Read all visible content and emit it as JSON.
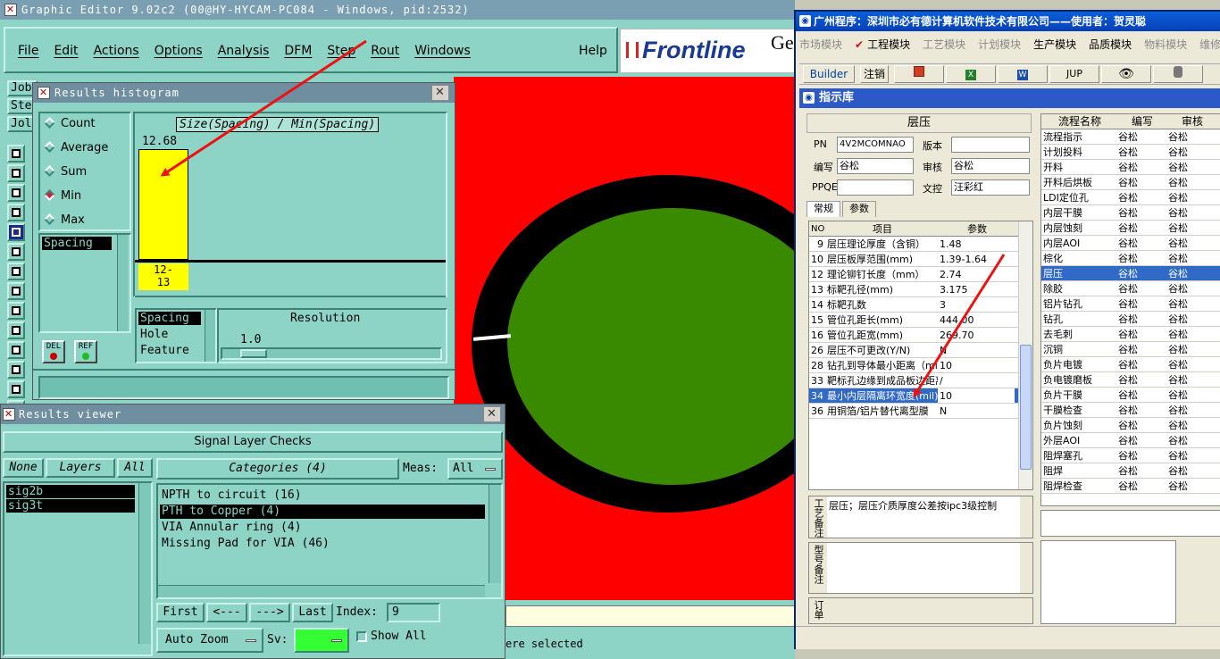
{
  "graphic_editor": {
    "title": "Graphic Editor 9.02c2 (00@HY-HYCAM-PC084 - Windows, pid:2532)",
    "menu": [
      "File",
      "Edit",
      "Actions",
      "Options",
      "Analysis",
      "DFM",
      "Step",
      "Rout",
      "Windows"
    ],
    "help": "Help",
    "logo": "Frontline",
    "logo_suffix": "Ge",
    "side_labels": [
      "Job",
      "Ste",
      "Jol"
    ],
    "status_text": "ere selected",
    "colors": {
      "canvas": "#ff0000",
      "ring": "#000000",
      "pad": "#3a8a00"
    }
  },
  "histogram": {
    "title": "Results histogram",
    "modes": [
      {
        "label": "Count",
        "selected": false
      },
      {
        "label": "Average",
        "selected": false
      },
      {
        "label": "Sum",
        "selected": false
      },
      {
        "label": "Min",
        "selected": true
      },
      {
        "label": "Max",
        "selected": false
      }
    ],
    "list_item": "Spacing",
    "del_label": "DEL",
    "ref_label": "REF",
    "chart_title": "Size(Spacing) / Min(Spacing)",
    "bar_value": "12.68",
    "bar_category": "12-\n13",
    "types": [
      "Spacing",
      "Hole",
      "Feature"
    ],
    "resolution_label": "Resolution",
    "resolution_value": "1.0"
  },
  "results_viewer": {
    "title": "Results viewer",
    "header": "Signal Layer Checks",
    "none_label": "None",
    "layers_label": "Layers",
    "all_label": "All",
    "layers": [
      "sig2b",
      "sig3t"
    ],
    "categories_label": "Categories (4)",
    "meas_label": "Meas:",
    "meas_value": "All",
    "categories": [
      {
        "label": "NPTH to circuit (16)",
        "selected": false
      },
      {
        "label": "PTH to Copper (4)",
        "selected": true
      },
      {
        "label": "VIA Annular ring (4)",
        "selected": false
      },
      {
        "label": "Missing Pad for VIA (46)",
        "selected": false
      }
    ],
    "first_label": "First",
    "prev_label": "<---",
    "next_label": "--->",
    "last_label": "Last",
    "index_label": "Index:",
    "index_value": "9",
    "auto_zoom_label": "Auto Zoom",
    "sv_label": "Sv:",
    "show_all_label": "Show All"
  },
  "cn_app": {
    "title": "广州程序：深圳市必有德计算机软件技术有限公司——使用者：贺灵聪",
    "modules": [
      {
        "label": "市场模块",
        "active": false
      },
      {
        "label": "工程模块",
        "active": true
      },
      {
        "label": "工艺模块",
        "active": false
      },
      {
        "label": "计划模块",
        "active": false
      },
      {
        "label": "生产模块",
        "active": true
      },
      {
        "label": "品质模块",
        "active": true
      },
      {
        "label": "物料模块",
        "active": false
      },
      {
        "label": "维修",
        "active": false
      }
    ],
    "toolbar": {
      "builder": "Builder",
      "logout": "注销",
      "jup": "JUP"
    },
    "sub_title": "指示库",
    "section_title": "层压",
    "form": {
      "pn_label": "PN",
      "pn_value": "4V2MCOMNAO",
      "version_label": "版本",
      "version_value": "",
      "writer_label": "编写",
      "writer_value": "谷松",
      "review_label": "审核",
      "review_value": "谷松",
      "ppqe_label": "PPQE",
      "ppqe_value": "",
      "doc_label": "文控",
      "doc_value": "汪彩红"
    },
    "tabs": [
      "常规",
      "参数"
    ],
    "param_headers": [
      "NO",
      "项目",
      "参数"
    ],
    "params": [
      {
        "no": "9",
        "item": "层压理论厚度（含铜）",
        "value": "1.48",
        "selected": false
      },
      {
        "no": "10",
        "item": "层压板厚范围(mm)",
        "value": "1.39-1.64",
        "selected": false
      },
      {
        "no": "12",
        "item": "理论铆钉长度（mm）",
        "value": "2.74",
        "selected": false
      },
      {
        "no": "13",
        "item": "标靶孔径(mm)",
        "value": "3.175",
        "selected": false
      },
      {
        "no": "14",
        "item": "标靶孔数",
        "value": "3",
        "selected": false
      },
      {
        "no": "15",
        "item": "管位孔距长(mm)",
        "value": "444.00",
        "selected": false
      },
      {
        "no": "16",
        "item": "管位孔距宽(mm)",
        "value": "269.70",
        "selected": false
      },
      {
        "no": "26",
        "item": "层压不可更改(Y/N)",
        "value": "N",
        "selected": false
      },
      {
        "no": "28",
        "item": "钻孔到导体最小距离（mil）",
        "value": "10",
        "selected": false
      },
      {
        "no": "33",
        "item": "靶标孔边缘到成品板边距离",
        "value": "/",
        "selected": false
      },
      {
        "no": "34",
        "item": "最小内层隔离环宽度(mil)",
        "value": "10",
        "selected": true
      },
      {
        "no": "36",
        "item": "用铜箔/铝片替代离型膜",
        "value": "N",
        "selected": false
      }
    ],
    "process_note_label": "工艺备注",
    "process_note": "层压；层压介质厚度公差按ipc3级控制",
    "type_note_label": "型号备注",
    "order_label": "订单",
    "flow_headers": [
      "流程名称",
      "编写",
      "审核"
    ],
    "flows": [
      {
        "name": "流程指示",
        "writer": "谷松",
        "review": "谷松",
        "selected": false
      },
      {
        "name": "计划投料",
        "writer": "谷松",
        "review": "谷松",
        "selected": false
      },
      {
        "name": "开料",
        "writer": "谷松",
        "review": "谷松",
        "selected": false
      },
      {
        "name": "开料后烘板",
        "writer": "谷松",
        "review": "谷松",
        "selected": false
      },
      {
        "name": "LDI定位孔",
        "writer": "谷松",
        "review": "谷松",
        "selected": false
      },
      {
        "name": "内层干膜",
        "writer": "谷松",
        "review": "谷松",
        "selected": false
      },
      {
        "name": "内层蚀刻",
        "writer": "谷松",
        "review": "谷松",
        "selected": false
      },
      {
        "name": "内层AOI",
        "writer": "谷松",
        "review": "谷松",
        "selected": false
      },
      {
        "name": "棕化",
        "writer": "谷松",
        "review": "谷松",
        "selected": false
      },
      {
        "name": "层压",
        "writer": "谷松",
        "review": "谷松",
        "selected": true
      },
      {
        "name": "除胶",
        "writer": "谷松",
        "review": "谷松",
        "selected": false
      },
      {
        "name": "铝片钻孔",
        "writer": "谷松",
        "review": "谷松",
        "selected": false
      },
      {
        "name": "钻孔",
        "writer": "谷松",
        "review": "谷松",
        "selected": false
      },
      {
        "name": "去毛刺",
        "writer": "谷松",
        "review": "谷松",
        "selected": false
      },
      {
        "name": "沉铜",
        "writer": "谷松",
        "review": "谷松",
        "selected": false
      },
      {
        "name": "负片电镀",
        "writer": "谷松",
        "review": "谷松",
        "selected": false
      },
      {
        "name": "负电镀磨板",
        "writer": "谷松",
        "review": "谷松",
        "selected": false
      },
      {
        "name": "负片干膜",
        "writer": "谷松",
        "review": "谷松",
        "selected": false
      },
      {
        "name": "干膜检查",
        "writer": "谷松",
        "review": "谷松",
        "selected": false
      },
      {
        "name": "负片蚀刻",
        "writer": "谷松",
        "review": "谷松",
        "selected": false
      },
      {
        "name": "外层AOI",
        "writer": "谷松",
        "review": "谷松",
        "selected": false
      },
      {
        "name": "阻焊塞孔",
        "writer": "谷松",
        "review": "谷松",
        "selected": false
      },
      {
        "name": "阻焊",
        "writer": "谷松",
        "review": "谷松",
        "selected": false
      },
      {
        "name": "阻焊检查",
        "writer": "谷松",
        "review": "谷松",
        "selected": false
      }
    ]
  }
}
